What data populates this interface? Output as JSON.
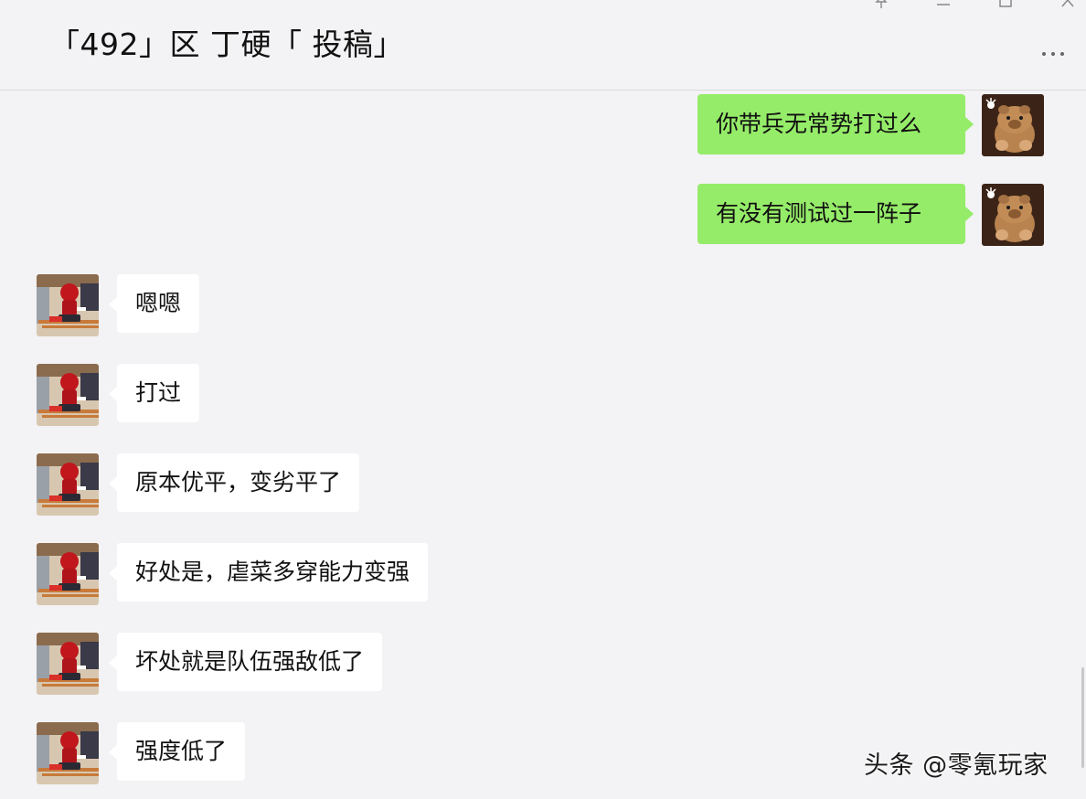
{
  "window": {
    "title": "「492」区 丁硬「 投稿」",
    "controls": [
      "pin-icon",
      "minimize-icon",
      "maximize-icon",
      "close-icon"
    ],
    "more_icon": "more-dots-icon"
  },
  "colors": {
    "background": "#f3f2f4",
    "outgoing_bubble": "#95ec69",
    "incoming_bubble": "#ffffff"
  },
  "messages": [
    {
      "direction": "out",
      "text": "你带兵无常势打过么",
      "avatar": "bear-avatar-icon"
    },
    {
      "direction": "out",
      "text": "有没有测试过一阵子",
      "avatar": "bear-avatar-icon"
    },
    {
      "direction": "in",
      "text": "嗯嗯",
      "avatar": "red-figure-avatar-icon"
    },
    {
      "direction": "in",
      "text": "打过",
      "avatar": "red-figure-avatar-icon"
    },
    {
      "direction": "in",
      "text": "原本优平，变劣平了",
      "avatar": "red-figure-avatar-icon"
    },
    {
      "direction": "in",
      "text": "好处是，虐菜多穿能力变强",
      "avatar": "red-figure-avatar-icon"
    },
    {
      "direction": "in",
      "text": "坏处就是队伍强敌低了",
      "avatar": "red-figure-avatar-icon"
    },
    {
      "direction": "in",
      "text": "强度低了",
      "avatar": "red-figure-avatar-icon"
    }
  ],
  "watermark": "头条 @零氪玩家"
}
